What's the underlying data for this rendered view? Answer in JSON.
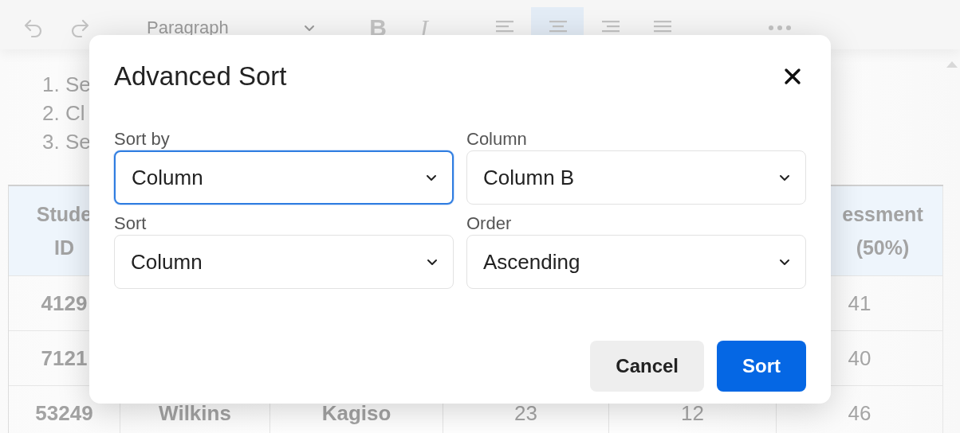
{
  "toolbar": {
    "items": [
      {
        "kind": "undo"
      },
      {
        "kind": "redo"
      },
      {
        "kind": "dropdown",
        "value": "Paragraph"
      },
      {
        "kind": "bold",
        "label": "B"
      },
      {
        "kind": "italic",
        "label": "I"
      },
      {
        "kind": "align-left",
        "selected": false
      },
      {
        "kind": "align-center",
        "selected": true
      },
      {
        "kind": "align-right",
        "selected": false
      },
      {
        "kind": "align-justify",
        "selected": false
      },
      {
        "kind": "more"
      }
    ]
  },
  "document": {
    "list": [
      "1. Se",
      "2. Cl",
      "3. Se"
    ],
    "table": {
      "header": {
        "column_1": "Stude\nID",
        "column_6": "essment\n(50%)"
      },
      "rows": [
        {
          "column_1": "4129",
          "column_6": "41"
        },
        {
          "column_1": "7121",
          "column_6": "40"
        },
        {
          "column_1": "53249",
          "column_2": "Wilkins",
          "column_3": "Kagiso",
          "column_4": "23",
          "column_5": "12",
          "column_6": "46"
        }
      ]
    }
  },
  "dialog": {
    "title": "Advanced Sort",
    "fields": [
      {
        "label": "Sort by",
        "value": "Column",
        "focused": true
      },
      {
        "label": "Column",
        "value": "Column B",
        "focused": false
      },
      {
        "label": "Sort",
        "value": "Column",
        "focused": false
      },
      {
        "label": "Order",
        "value": "Ascending",
        "focused": false
      }
    ],
    "buttons": [
      {
        "label": "Cancel",
        "kind": "secondary"
      },
      {
        "label": "Sort",
        "kind": "primary"
      }
    ]
  }
}
